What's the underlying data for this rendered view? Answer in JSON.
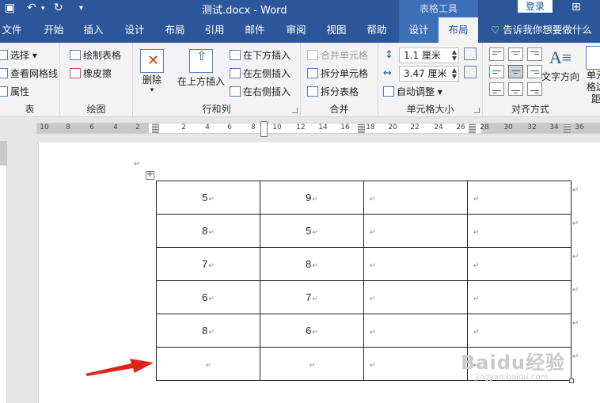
{
  "titlebar": {
    "doc_title": "测试.docx - Word",
    "context_tools": "表格工具",
    "login": "登录"
  },
  "tabs": [
    {
      "label": "文件"
    },
    {
      "label": "开始"
    },
    {
      "label": "插入"
    },
    {
      "label": "设计"
    },
    {
      "label": "布局"
    },
    {
      "label": "引用"
    },
    {
      "label": "邮件"
    },
    {
      "label": "审阅"
    },
    {
      "label": "视图"
    },
    {
      "label": "帮助"
    },
    {
      "label": "设计"
    },
    {
      "label": "布局"
    }
  ],
  "tell_me": "告诉我你想要做什么",
  "ribbon": {
    "table_group": {
      "label": "表",
      "select": "选择",
      "view_gridlines": "查看网格线",
      "properties": "属性"
    },
    "draw_group": {
      "label": "绘图",
      "draw_table": "绘制表格",
      "eraser": "橡皮擦"
    },
    "rowscols_group": {
      "label": "行和列",
      "delete": "删除",
      "insert_above": "在上方插入",
      "insert_below": "在下方插入",
      "insert_left": "在左侧插入",
      "insert_right": "在右侧插入"
    },
    "merge_group": {
      "label": "合并",
      "merge_cells": "合并单元格",
      "split_cells": "拆分单元格",
      "split_table": "拆分表格"
    },
    "cellsize_group": {
      "label": "单元格大小",
      "height": "1.1 厘米",
      "width": "3.47 厘米",
      "autofit": "自动调整"
    },
    "align_group": {
      "label": "对齐方式",
      "text_direction": "文字方向",
      "cell_margins": "单元格边距"
    }
  },
  "ruler_ticks": [
    "10",
    "8",
    "6",
    "4",
    "2",
    "2",
    "4",
    "6",
    "8",
    "10",
    "12",
    "14",
    "16",
    "18",
    "20",
    "22",
    "24",
    "26",
    "28",
    "30",
    "32",
    "34",
    "36"
  ],
  "table": {
    "rows": [
      [
        "5",
        "9",
        "",
        ""
      ],
      [
        "8",
        "5",
        "",
        ""
      ],
      [
        "7",
        "8",
        "",
        ""
      ],
      [
        "6",
        "7",
        "",
        ""
      ],
      [
        "8",
        "6",
        "",
        ""
      ],
      [
        "",
        "",
        "",
        ""
      ]
    ]
  },
  "watermark": {
    "main": "Baidu经验",
    "sub": "jingyan.baidu.com"
  },
  "colors": {
    "word_blue": "#2b579a",
    "context_blue": "#3d6fb6",
    "arrow_red": "#e0241c"
  }
}
